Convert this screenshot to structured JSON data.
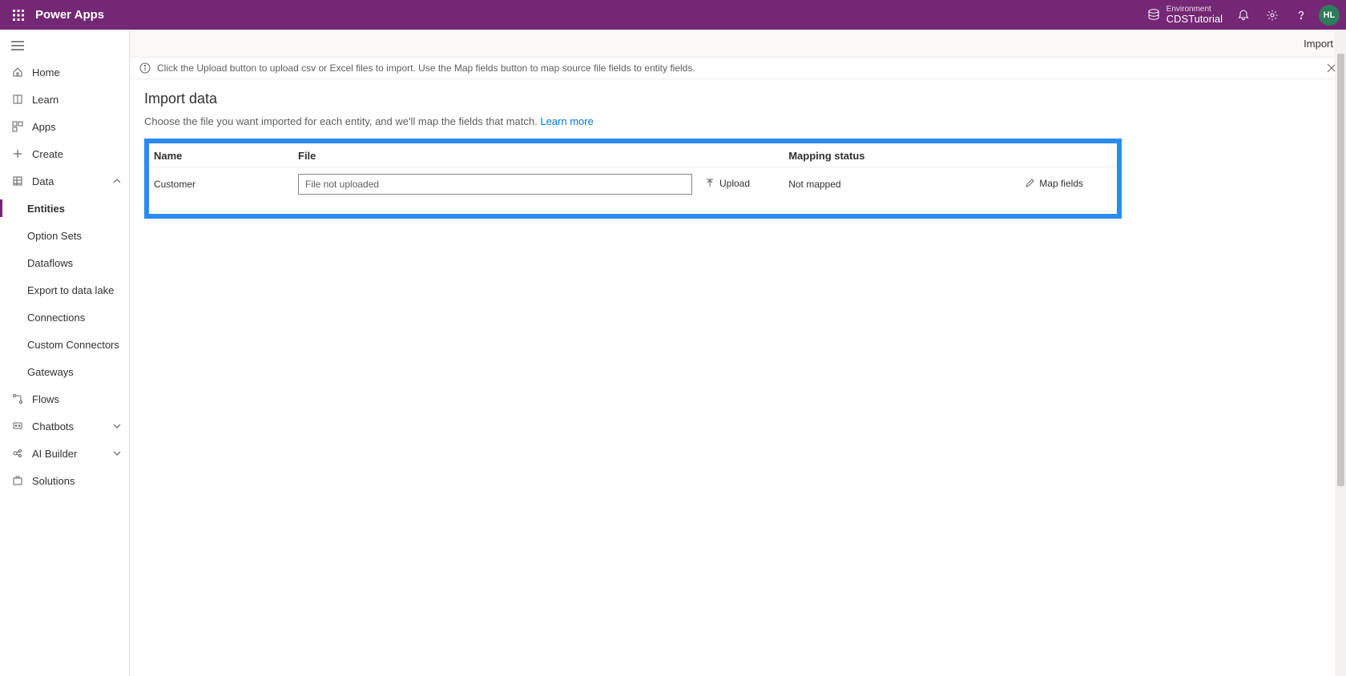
{
  "topbar": {
    "app_name": "Power Apps",
    "environment_label": "Environment",
    "environment_name": "CDSTutorial",
    "avatar_initials": "HL"
  },
  "sidebar": {
    "home": "Home",
    "learn": "Learn",
    "apps": "Apps",
    "create": "Create",
    "data": "Data",
    "data_children": {
      "entities": "Entities",
      "option_sets": "Option Sets",
      "dataflows": "Dataflows",
      "export_lake": "Export to data lake",
      "connections": "Connections",
      "custom_connectors": "Custom Connectors",
      "gateways": "Gateways"
    },
    "flows": "Flows",
    "chatbots": "Chatbots",
    "ai_builder": "AI Builder",
    "solutions": "Solutions"
  },
  "cmdbar": {
    "import": "Import"
  },
  "infobar": {
    "text": "Click the Upload button to upload csv or Excel files to import. Use the Map fields button to map source file fields to entity fields."
  },
  "page": {
    "title": "Import data",
    "desc": "Choose the file you want imported for each entity, and we'll map the fields that match. ",
    "learn_more": "Learn more"
  },
  "table": {
    "headers": {
      "name": "Name",
      "file": "File",
      "status": "Mapping status"
    },
    "row": {
      "name": "Customer",
      "file_placeholder": "File not uploaded",
      "upload_label": "Upload",
      "status": "Not mapped",
      "map_fields_label": "Map fields"
    }
  }
}
